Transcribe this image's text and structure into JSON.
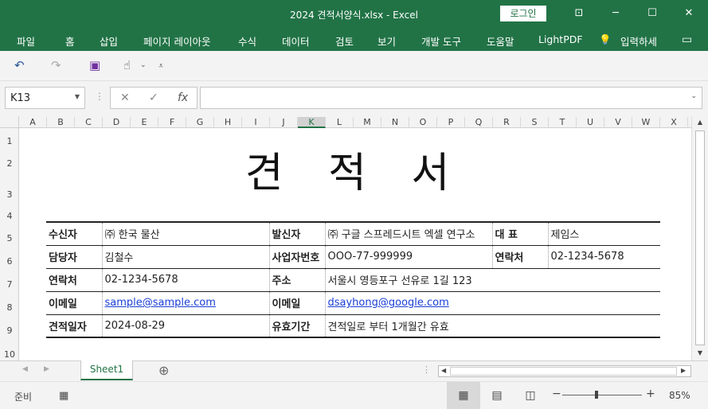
{
  "window": {
    "title": "2024 견적서양식.xlsx  -  Excel",
    "login_label": "로그인",
    "controls": [
      "⊡",
      "─",
      "☐",
      "✕"
    ]
  },
  "ribbon": {
    "tabs": [
      "파일",
      "홈",
      "삽입",
      "페이지 레이아웃",
      "수식",
      "데이터",
      "검토",
      "보기",
      "개발 도구",
      "도움말",
      "LightPDF"
    ],
    "tell_me": "입력하세"
  },
  "formula_bar": {
    "name_box": "K13",
    "formula": ""
  },
  "columns": [
    "A",
    "B",
    "C",
    "D",
    "E",
    "F",
    "G",
    "H",
    "I",
    "J",
    "K",
    "L",
    "M",
    "N",
    "O",
    "P",
    "Q",
    "R",
    "S",
    "T",
    "U",
    "V",
    "W",
    "X"
  ],
  "selected_column": "K",
  "rows": [
    "1",
    "2",
    "3",
    "4",
    "5",
    "6",
    "7",
    "8",
    "9",
    "10"
  ],
  "document": {
    "title": "견 적 서",
    "rows": [
      [
        {
          "t": "수신자",
          "lab": true
        },
        {
          "t": "㈜ 한국 물산"
        },
        {
          "t": "발신자",
          "lab": true
        },
        {
          "t": "㈜ 구글 스프레드시트 엑셀 연구소"
        },
        {
          "t": "대    표",
          "lab": true
        },
        {
          "t": "제임스"
        }
      ],
      [
        {
          "t": "담당자",
          "lab": true
        },
        {
          "t": "김철수"
        },
        {
          "t": "사업자번호",
          "lab": true
        },
        {
          "t": "OOO-77-999999"
        },
        {
          "t": "연락처",
          "lab": true
        },
        {
          "t": "02-1234-5678"
        }
      ],
      [
        {
          "t": "연락처",
          "lab": true
        },
        {
          "t": "02-1234-5678"
        },
        {
          "t": "주소",
          "lab": true
        },
        {
          "t": "서울시 영등포구 선유로 1길 123",
          "span": 3
        }
      ],
      [
        {
          "t": "이메일",
          "lab": true
        },
        {
          "t": "sample@sample.com",
          "link": true
        },
        {
          "t": "이메일",
          "lab": true
        },
        {
          "t": "dsayhong@google.com",
          "link": true,
          "span": 3
        }
      ],
      [
        {
          "t": "견적일자",
          "lab": true
        },
        {
          "t": "2024-08-29"
        },
        {
          "t": "유효기간",
          "lab": true
        },
        {
          "t": "견적일로 부터 1개월간 유효",
          "span": 3
        }
      ]
    ]
  },
  "sheet_tabs": {
    "active": "Sheet1"
  },
  "status": {
    "ready": "준비",
    "zoom": "85%"
  }
}
